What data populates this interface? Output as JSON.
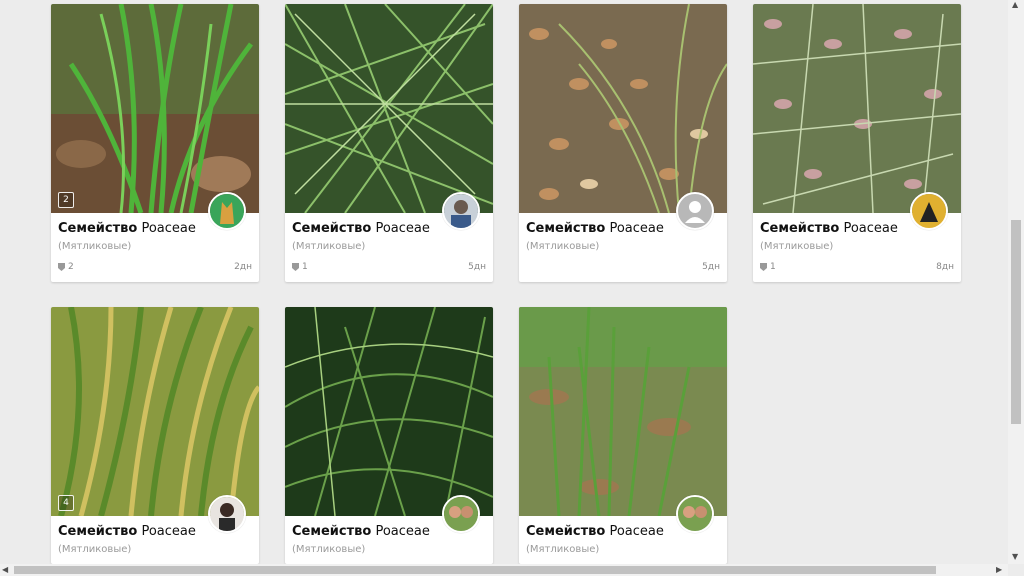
{
  "observations": [
    {
      "title_bold": "Семейство",
      "title_name": "Poaceae",
      "subtitle": "(Мятликовые)",
      "photo_count": "2",
      "ids": "2",
      "time": "2дн",
      "avatar": "dog-avatar",
      "photo": "grass-dry-leaves"
    },
    {
      "title_bold": "Семейство",
      "title_name": "Poaceae",
      "subtitle": "(Мятликовые)",
      "photo_count": "",
      "ids": "1",
      "time": "5дн",
      "avatar": "husky-avatar",
      "photo": "dense-grass"
    },
    {
      "title_bold": "Семейство",
      "title_name": "Poaceae",
      "subtitle": "(Мятликовые)",
      "photo_count": "",
      "ids": "",
      "time": "5дн",
      "avatar": "default-user-avatar",
      "photo": "grass-fallen-leaves"
    },
    {
      "title_bold": "Семейство",
      "title_name": "Poaceae",
      "subtitle": "(Мятликовые)",
      "photo_count": "",
      "ids": "1",
      "time": "8дн",
      "avatar": "bird-avatar",
      "photo": "grass-pink-leaves"
    },
    {
      "title_bold": "Семейство",
      "title_name": "Poaceae",
      "subtitle": "(Мятликовые)",
      "photo_count": "4",
      "ids": "",
      "time": "",
      "avatar": "woman-avatar",
      "photo": "yellow-green-grass"
    },
    {
      "title_bold": "Семейство",
      "title_name": "Poaceae",
      "subtitle": "(Мятликовые)",
      "photo_count": "",
      "ids": "",
      "time": "",
      "avatar": "couple-avatar",
      "photo": "dark-grass"
    },
    {
      "title_bold": "Семейство",
      "title_name": "Poaceae",
      "subtitle": "(Мятликовые)",
      "photo_count": "",
      "ids": "",
      "time": "",
      "avatar": "couple-avatar",
      "photo": "meadow-grass"
    }
  ],
  "colors": {
    "background": "#ececec",
    "card": "#ffffff",
    "muted_text": "#9a9a9a"
  }
}
